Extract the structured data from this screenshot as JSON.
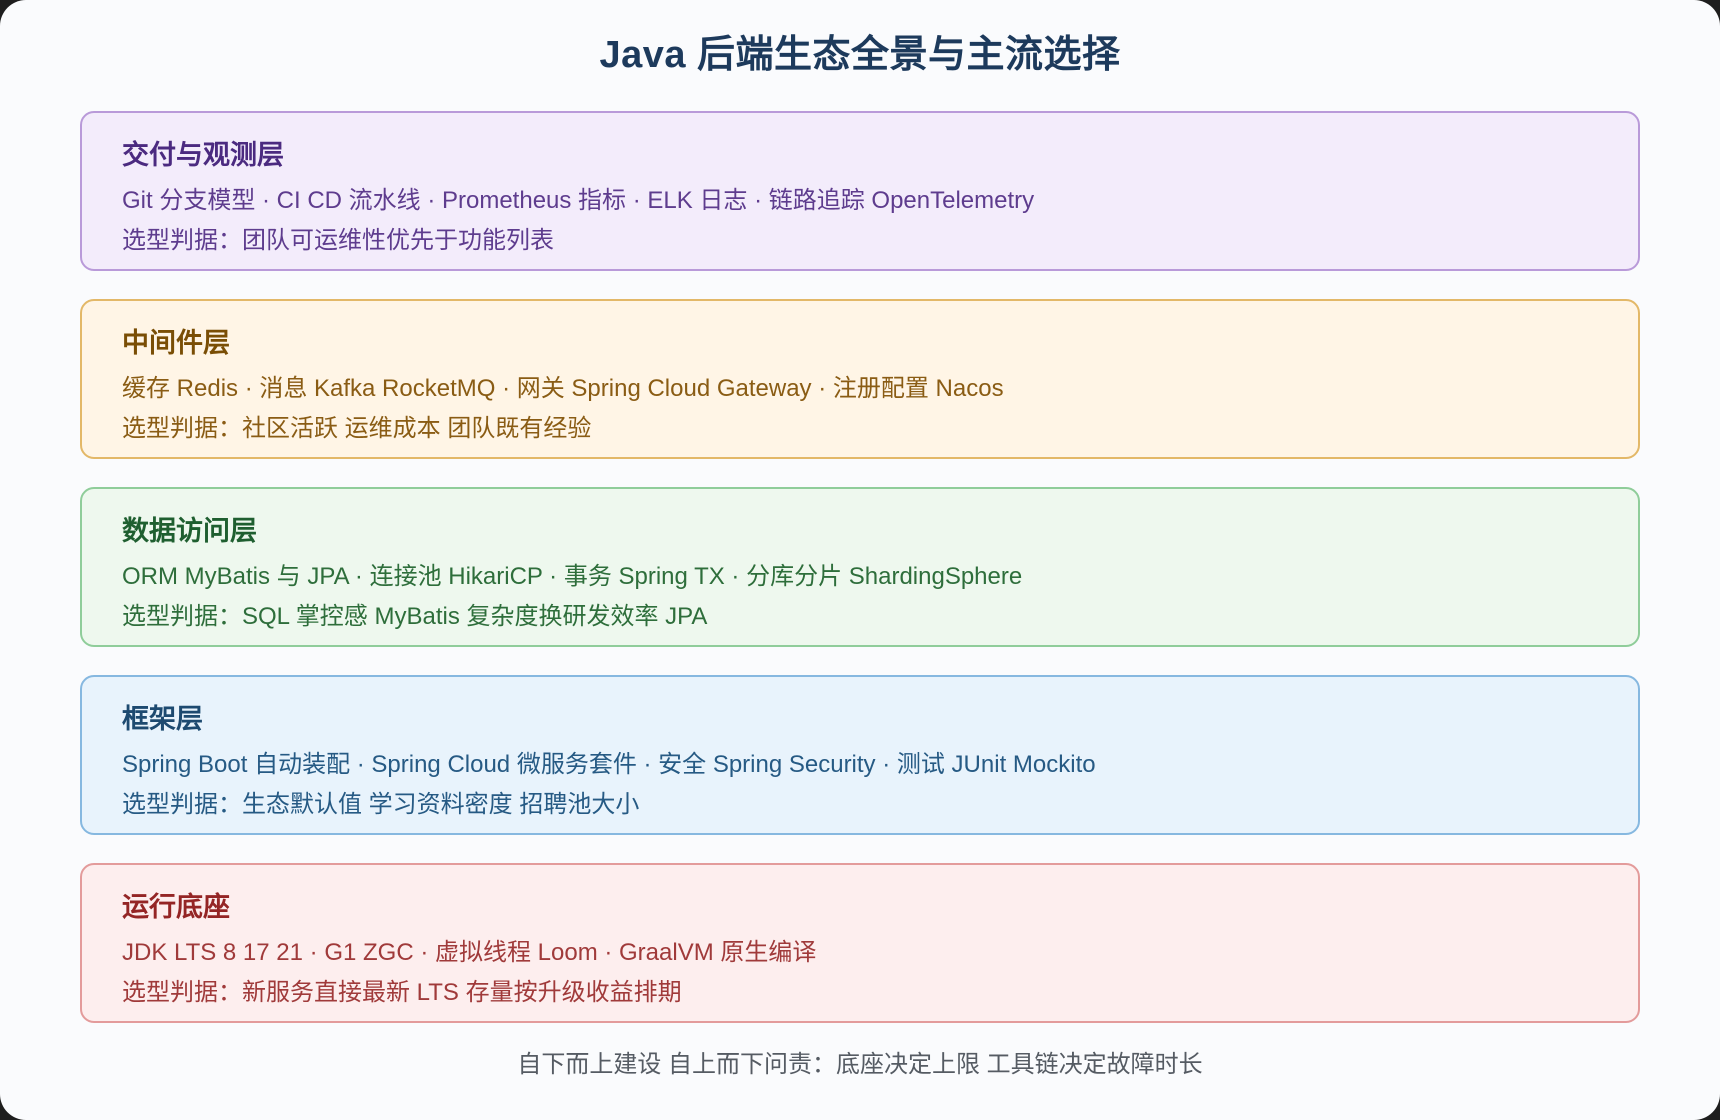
{
  "title": "Java 后端生态全景与主流选择",
  "layers": [
    {
      "name": "交付与观测层",
      "items": "Git 分支模型 · CI CD 流水线 · Prometheus 指标 · ELK 日志 · 链路追踪 OpenTelemetry",
      "note": "选型判据：团队可运维性优先于功能列表",
      "colors": {
        "bg": "#f3ecfb",
        "border": "#b99ad9",
        "title": "#4b2a80",
        "text": "#5e3c8e"
      }
    },
    {
      "name": "中间件层",
      "items": "缓存 Redis · 消息 Kafka RocketMQ · 网关 Spring Cloud Gateway · 注册配置 Nacos",
      "note": "选型判据：社区活跃 运维成本 团队既有经验",
      "colors": {
        "bg": "#fff5e6",
        "border": "#e3b868",
        "title": "#7a4e05",
        "text": "#8a5c14"
      }
    },
    {
      "name": "数据访问层",
      "items": "ORM MyBatis 与 JPA · 连接池 HikariCP · 事务 Spring TX · 分库分片 ShardingSphere",
      "note": "选型判据：SQL 掌控感 MyBatis 复杂度换研发效率 JPA",
      "colors": {
        "bg": "#eef8ee",
        "border": "#8fcd9a",
        "title": "#1f5f30",
        "text": "#2e6e3b"
      }
    },
    {
      "name": "框架层",
      "items": "Spring Boot 自动装配 · Spring Cloud 微服务套件 · 安全 Spring Security · 测试 JUnit Mockito",
      "note": "选型判据：生态默认值 学习资料密度 招聘池大小",
      "colors": {
        "bg": "#e8f3fc",
        "border": "#86b8e0",
        "title": "#1d4a70",
        "text": "#265a84"
      }
    },
    {
      "name": "运行底座",
      "items": "JDK LTS 8 17 21 · G1 ZGC · 虚拟线程 Loom · GraalVM 原生编译",
      "note": "选型判据：新服务直接最新 LTS 存量按升级收益排期",
      "colors": {
        "bg": "#fdeeee",
        "border": "#e39b9b",
        "title": "#942525",
        "text": "#a03a3a"
      }
    }
  ],
  "footer": "自下而上建设 自上而下问责：底座决定上限 工具链决定故障时长"
}
